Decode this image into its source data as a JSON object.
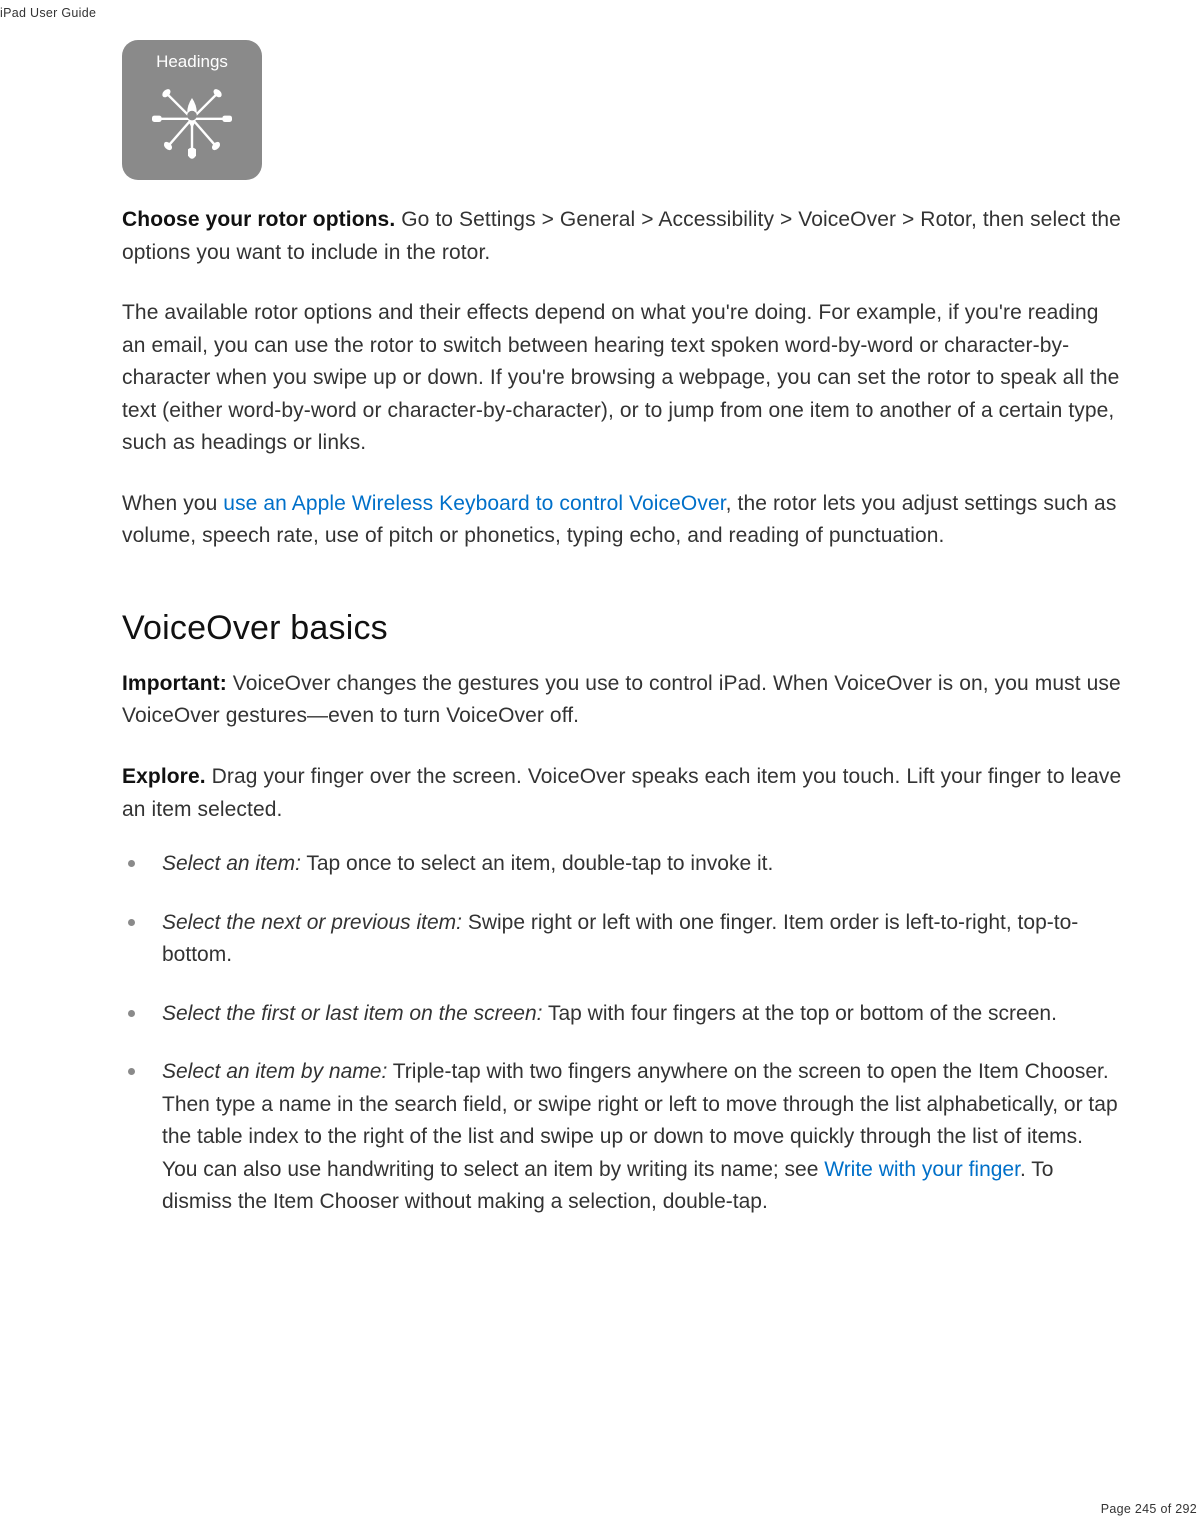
{
  "header": {
    "title": "iPad User Guide"
  },
  "rotor_image": {
    "label": "Headings"
  },
  "paragraphs": {
    "choose_bold": "Choose your rotor options.",
    "choose_rest": " Go to Settings > General > Accessibility > VoiceOver > Rotor, then select the options you want to include in the rotor.",
    "available": "The available rotor options and their effects depend on what you're doing. For example, if you're reading an email, you can use the rotor to switch between hearing text spoken word-by-word or character-by-character when you swipe up or down. If you're browsing a webpage, you can set the rotor to speak all the text (either word-by-word or character-by-character), or to jump from one item to another of a certain type, such as headings or links.",
    "when_pre": "When you ",
    "when_link": "use an Apple Wireless Keyboard to control VoiceOver",
    "when_post": ", the rotor lets you adjust settings such as volume, speech rate, use of pitch or phonetics, typing echo, and reading of punctuation."
  },
  "section2": {
    "heading": "VoiceOver basics",
    "important_bold": "Important:",
    "important_rest": " VoiceOver changes the gestures you use to control iPad. When VoiceOver is on, you must use VoiceOver gestures—even to turn VoiceOver off.",
    "explore_bold": "Explore.",
    "explore_rest": " Drag your finger over the screen. VoiceOver speaks each item you touch. Lift your finger to leave an item selected."
  },
  "bullets": [
    {
      "lead": "Select an item:",
      "rest": " Tap once to select an item, double-tap to invoke it."
    },
    {
      "lead": "Select the next or previous item:",
      "rest": " Swipe right or left with one finger. Item order is left-to-right, top-to-bottom."
    },
    {
      "lead": "Select the first or last item on the screen:",
      "rest": " Tap with four fingers at the top or bottom of the screen."
    },
    {
      "lead": "Select an item by name:",
      "rest_pre": " Triple-tap with two fingers anywhere on the screen to open the Item Chooser. Then type a name in the search field, or swipe right or left to move through the list alphabetically, or tap the table index to the right of the list and swipe up or down to move quickly through the list of items. You can also use handwriting to select an item by writing its name; see ",
      "link": "Write with your finger",
      "rest_post": ". To dismiss the Item Chooser without making a selection, double-tap."
    }
  ],
  "footer": {
    "page": "Page 245 of 292"
  }
}
